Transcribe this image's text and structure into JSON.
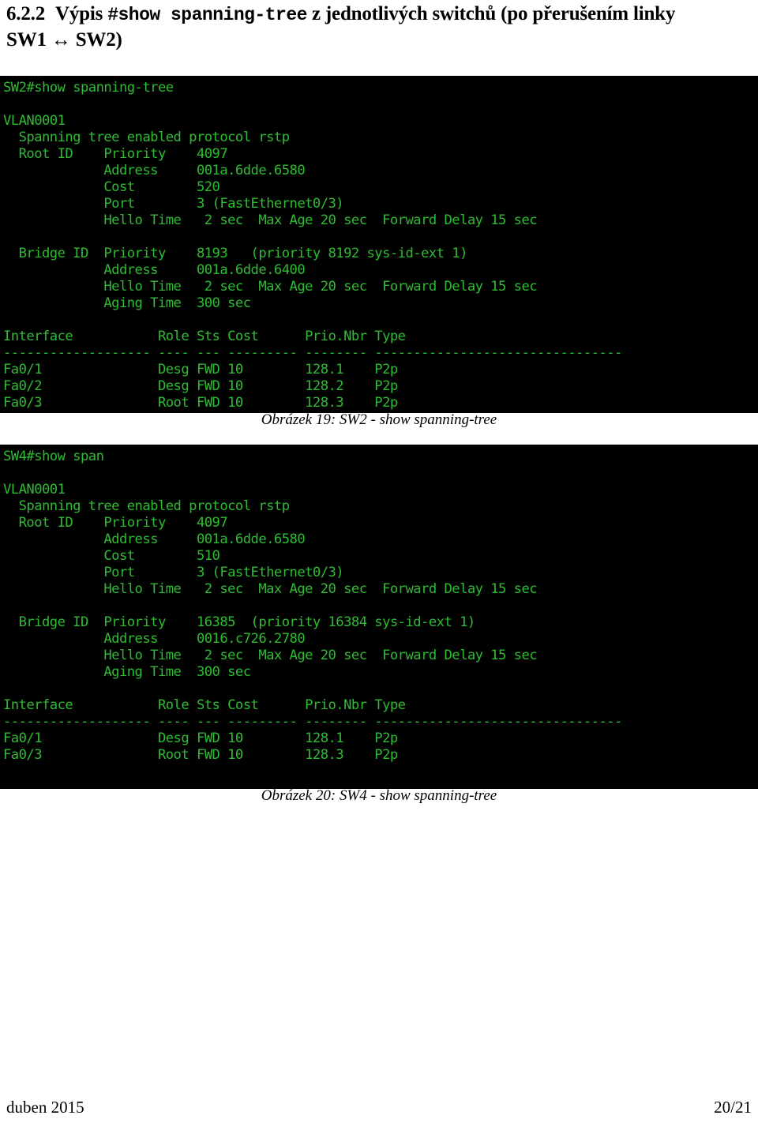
{
  "heading": {
    "number": "6.2.2",
    "part1": "Výpis ",
    "mono": "#show spanning-tree",
    "part2": " z jednotlivých switchů (po přerušením linky SW1 ↔ SW2)"
  },
  "terminal_sw2": {
    "prompt": "SW2#show spanning-tree",
    "lines": [
      "SW2#show spanning-tree",
      "",
      "VLAN0001",
      "  Spanning tree enabled protocol rstp",
      "  Root ID    Priority    4097",
      "             Address     001a.6dde.6580",
      "             Cost        520",
      "             Port        3 (FastEthernet0/3)",
      "             Hello Time   2 sec  Max Age 20 sec  Forward Delay 15 sec",
      "",
      "  Bridge ID  Priority    8193   (priority 8192 sys-id-ext 1)",
      "             Address     001a.6dde.6400",
      "             Hello Time   2 sec  Max Age 20 sec  Forward Delay 15 sec",
      "             Aging Time  300 sec",
      "",
      "Interface           Role Sts Cost      Prio.Nbr Type",
      "------------------- ---- --- --------- -------- --------------------------------",
      "Fa0/1               Desg FWD 10        128.1    P2p",
      "Fa0/2               Desg FWD 10        128.2    P2p",
      "Fa0/3               Root FWD 10        128.3    P2p"
    ],
    "fields": {
      "vlan": "VLAN0001",
      "protocol": "rstp",
      "root_priority": "4097",
      "root_address": "001a.6dde.6580",
      "root_cost": "520",
      "root_port": "3 (FastEthernet0/3)",
      "root_hello_time": "2 sec",
      "root_max_age": "20 sec",
      "root_forward_delay": "15 sec",
      "bridge_priority": "8193",
      "bridge_priority_detail": "(priority 8192 sys-id-ext 1)",
      "bridge_address": "001a.6dde.6400",
      "bridge_hello_time": "2 sec",
      "bridge_max_age": "20 sec",
      "bridge_forward_delay": "15 sec",
      "aging_time": "300 sec"
    },
    "table": {
      "headers": [
        "Interface",
        "Role",
        "Sts",
        "Cost",
        "Prio.Nbr",
        "Type"
      ],
      "rows": [
        [
          "Fa0/1",
          "Desg",
          "FWD",
          "10",
          "128.1",
          "P2p"
        ],
        [
          "Fa0/2",
          "Desg",
          "FWD",
          "10",
          "128.2",
          "P2p"
        ],
        [
          "Fa0/3",
          "Root",
          "FWD",
          "10",
          "128.3",
          "P2p"
        ]
      ]
    }
  },
  "terminal_sw4": {
    "prompt": "SW4#show span",
    "lines": [
      "SW4#show span",
      "",
      "VLAN0001",
      "  Spanning tree enabled protocol rstp",
      "  Root ID    Priority    4097",
      "             Address     001a.6dde.6580",
      "             Cost        510",
      "             Port        3 (FastEthernet0/3)",
      "             Hello Time   2 sec  Max Age 20 sec  Forward Delay 15 sec",
      "",
      "  Bridge ID  Priority    16385  (priority 16384 sys-id-ext 1)",
      "             Address     0016.c726.2780",
      "             Hello Time   2 sec  Max Age 20 sec  Forward Delay 15 sec",
      "             Aging Time  300 sec",
      "",
      "Interface           Role Sts Cost      Prio.Nbr Type",
      "------------------- ---- --- --------- -------- --------------------------------",
      "Fa0/1               Desg FWD 10        128.1    P2p",
      "Fa0/3               Root FWD 10        128.3    P2p"
    ],
    "fields": {
      "vlan": "VLAN0001",
      "protocol": "rstp",
      "root_priority": "4097",
      "root_address": "001a.6dde.6580",
      "root_cost": "510",
      "root_port": "3 (FastEthernet0/3)",
      "root_hello_time": "2 sec",
      "root_max_age": "20 sec",
      "root_forward_delay": "15 sec",
      "bridge_priority": "16385",
      "bridge_priority_detail": "(priority 16384 sys-id-ext 1)",
      "bridge_address": "0016.c726.2780",
      "bridge_hello_time": "2 sec",
      "bridge_max_age": "20 sec",
      "bridge_forward_delay": "15 sec",
      "aging_time": "300 sec"
    },
    "table": {
      "headers": [
        "Interface",
        "Role",
        "Sts",
        "Cost",
        "Prio.Nbr",
        "Type"
      ],
      "rows": [
        [
          "Fa0/1",
          "Desg",
          "FWD",
          "10",
          "128.1",
          "P2p"
        ],
        [
          "Fa0/3",
          "Root",
          "FWD",
          "10",
          "128.3",
          "P2p"
        ]
      ]
    }
  },
  "captions": {
    "fig19": "Obrázek 19: SW2 - show spanning-tree",
    "fig20": "Obrázek 20: SW4 - show spanning-tree"
  },
  "footer": {
    "date": "duben 2015",
    "page": "20/21"
  },
  "colors": {
    "terminal_bg": "#000000",
    "terminal_fg": "#2fbb33",
    "page_bg": "#ffffff",
    "text": "#000000"
  }
}
